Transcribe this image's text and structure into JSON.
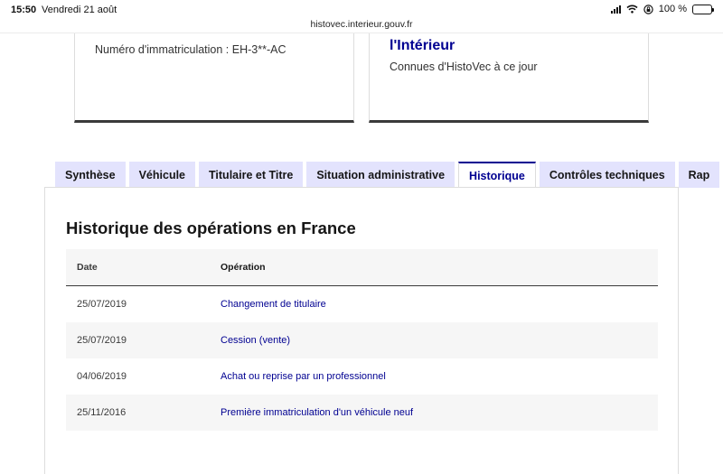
{
  "status_bar": {
    "time": "15:50",
    "date": "Vendredi 21 août",
    "battery": "100 %",
    "url": "histovec.interieur.gouv.fr"
  },
  "cards": {
    "left_text": "Numéro d'immatriculation : EH-3**-AC",
    "right_title": "l'Intérieur",
    "right_subtitle": "Connues d'HistoVec à ce jour"
  },
  "tabs": [
    {
      "label": "Synthèse",
      "active": false
    },
    {
      "label": "Véhicule",
      "active": false
    },
    {
      "label": "Titulaire et Titre",
      "active": false
    },
    {
      "label": "Situation administrative",
      "active": false
    },
    {
      "label": "Historique",
      "active": true
    },
    {
      "label": "Contrôles techniques",
      "active": false
    },
    {
      "label": "Rap",
      "active": false
    }
  ],
  "history": {
    "title": "Historique des opérations en France",
    "columns": {
      "date": "Date",
      "operation": "Opération"
    },
    "rows": [
      {
        "date": "25/07/2019",
        "operation": "Changement de titulaire"
      },
      {
        "date": "25/07/2019",
        "operation": "Cession (vente)"
      },
      {
        "date": "04/06/2019",
        "operation": "Achat ou reprise par un professionnel"
      },
      {
        "date": "25/11/2016",
        "operation": "Première immatriculation d'un véhicule neuf"
      }
    ]
  },
  "colors": {
    "brand_blue": "#000091",
    "tab_background": "#e3e3fd",
    "row_alt_background": "#f6f6f6"
  }
}
